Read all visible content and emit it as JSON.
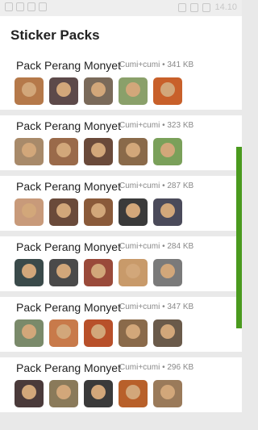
{
  "status_bar": {
    "time": "14.10"
  },
  "header": {
    "title": "Sticker Packs"
  },
  "packs": [
    {
      "name": "Pack Perang Monyet",
      "author": "Cumi+cumi",
      "size": "341 KB",
      "stickers": [
        {
          "name": "monkey-sitting-sticker",
          "color": "#b5794a"
        },
        {
          "name": "gorilla-sticker",
          "color": "#5d4a4a"
        },
        {
          "name": "ape-face-sticker",
          "color": "#7a6a5a"
        },
        {
          "name": "monkey-text-sticker",
          "color": "#8aa06a"
        },
        {
          "name": "orangutan-sticker",
          "color": "#c8602a"
        }
      ]
    },
    {
      "name": "Pack Perang Monyet",
      "author": "Cumi+cumi",
      "size": "323 KB",
      "stickers": [
        {
          "name": "monkey-caption-sticker",
          "color": "#a88a6a"
        },
        {
          "name": "monkey-lying-sticker",
          "color": "#9a6a4a"
        },
        {
          "name": "chimp-sticker",
          "color": "#6a4a3a"
        },
        {
          "name": "monkey-label-sticker",
          "color": "#8a6a4a"
        },
        {
          "name": "monkey-green-text-sticker",
          "color": "#7aa05a"
        }
      ]
    },
    {
      "name": "Pack Perang Monyet",
      "author": "Cumi+cumi",
      "size": "287 KB",
      "stickers": [
        {
          "name": "macaque-sticker",
          "color": "#c89a7a"
        },
        {
          "name": "baboon-sticker",
          "color": "#6a4a3a"
        },
        {
          "name": "three-monkeys-sticker",
          "color": "#8a5a3a"
        },
        {
          "name": "black-ape-sticker",
          "color": "#3a3a3a"
        },
        {
          "name": "gorilla-dark-sticker",
          "color": "#4a4a5a"
        }
      ]
    },
    {
      "name": "Pack Perang Monyet",
      "author": "Cumi+cumi",
      "size": "284 KB",
      "stickers": [
        {
          "name": "monkey-portrait-sticker",
          "color": "#3a4a4a"
        },
        {
          "name": "gorilla-caption-sticker",
          "color": "#4a4a4a"
        },
        {
          "name": "ape-red-sticker",
          "color": "#9a4a3a"
        },
        {
          "name": "monkey-laugh-sticker",
          "color": "#c89a6a"
        },
        {
          "name": "seal-sticker",
          "color": "#7a7a7a"
        }
      ]
    },
    {
      "name": "Pack Perang Monyet",
      "author": "Cumi+cumi",
      "size": "347 KB",
      "stickers": [
        {
          "name": "monkey-group-sticker",
          "color": "#7a8a6a"
        },
        {
          "name": "monkey-baby-sticker",
          "color": "#c87a4a"
        },
        {
          "name": "monkey-dance-sticker",
          "color": "#b8502a"
        },
        {
          "name": "chimp-text-sticker",
          "color": "#8a6a4a"
        },
        {
          "name": "oh-monkey-sticker",
          "color": "#6a5a4a"
        }
      ]
    },
    {
      "name": "Pack Perang Monyet",
      "author": "Cumi+cumi",
      "size": "296 KB",
      "stickers": [
        {
          "name": "chimp-caption-sticker",
          "color": "#4a3a3a"
        },
        {
          "name": "two-monkeys-sticker",
          "color": "#8a7a5a"
        },
        {
          "name": "gorilla-black-sticker",
          "color": "#3a3a3a"
        },
        {
          "name": "orangutan-caption-sticker",
          "color": "#b8602a"
        },
        {
          "name": "monkey-group2-sticker",
          "color": "#9a7a5a"
        }
      ]
    }
  ]
}
